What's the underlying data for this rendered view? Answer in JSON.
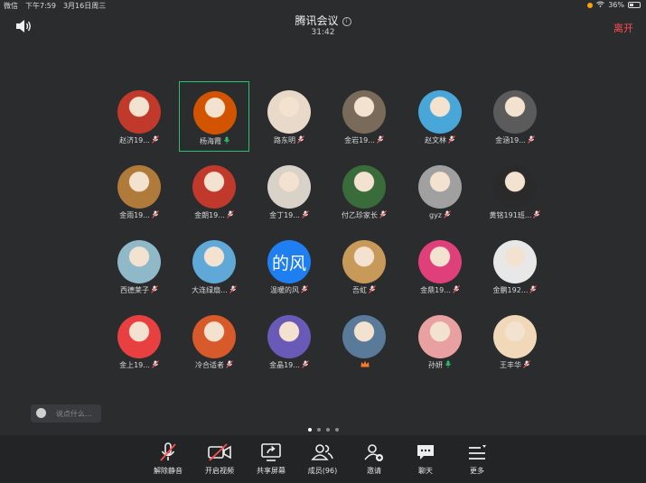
{
  "status_bar": {
    "carrier": "微信",
    "time": "下午7:59",
    "date": "3月16日周三",
    "battery": "36%"
  },
  "header": {
    "title": "腾讯会议",
    "timer": "31:42",
    "leave_label": "离开"
  },
  "participants": [
    {
      "name": "赵济19...",
      "muted": true,
      "color": "#c0392b"
    },
    {
      "name": "杨海霞",
      "muted": false,
      "active": true,
      "color": "#d35400"
    },
    {
      "name": "路东明",
      "muted": true,
      "color": "#e8d9c8"
    },
    {
      "name": "金岩19...",
      "muted": true,
      "color": "#7a6a5a"
    },
    {
      "name": "赵文林",
      "muted": true,
      "color": "#48a7d8"
    },
    {
      "name": "金涵19...",
      "muted": true,
      "color": "#5b5b5b"
    },
    {
      "name": "金雨19...",
      "muted": true,
      "color": "#b07a3a"
    },
    {
      "name": "金朗19...",
      "muted": true,
      "color": "#c0392b"
    },
    {
      "name": "金丁19...",
      "muted": true,
      "color": "#d8d2c8"
    },
    {
      "name": "付乙珍家长",
      "muted": true,
      "color": "#3a6b3a"
    },
    {
      "name": "gyz",
      "muted": true,
      "color": "#a0a0a0"
    },
    {
      "name": "黄铭191班...",
      "muted": true,
      "color": "#2a2a2a"
    },
    {
      "name": "西德莱子",
      "muted": true,
      "color": "#8fb8c8"
    },
    {
      "name": "大连绿扇...",
      "muted": true,
      "color": "#5fa8d8"
    },
    {
      "name": "温暖的风",
      "muted": true,
      "avatar_text": "的风",
      "color": "#1f7ff0"
    },
    {
      "name": "吾虹",
      "muted": true,
      "color": "#c89a5a"
    },
    {
      "name": "金鼎19...",
      "muted": true,
      "color": "#e0407a"
    },
    {
      "name": "金鹏192...",
      "muted": true,
      "color": "#e8e8e8"
    },
    {
      "name": "金上19...",
      "muted": true,
      "color": "#e84040"
    },
    {
      "name": "冷合适者",
      "muted": true,
      "color": "#d85a2a"
    },
    {
      "name": "金晶19...",
      "muted": true,
      "color": "#6a5ab8"
    },
    {
      "name": "",
      "muted": false,
      "host_crown": true,
      "color": "#5a7a9a"
    },
    {
      "name": "孙妍",
      "muted": false,
      "color": "#e8a0a0"
    },
    {
      "name": "王丰华",
      "muted": true,
      "color": "#f0d8b8"
    }
  ],
  "chat": {
    "placeholder": "说点什么..."
  },
  "pagination": {
    "pages": 4,
    "current": 1
  },
  "toolbar": [
    {
      "key": "unmute",
      "label": "解除静音",
      "icon": "mic-off-icon"
    },
    {
      "key": "video",
      "label": "开启视频",
      "icon": "camera-off-icon"
    },
    {
      "key": "share",
      "label": "共享屏幕",
      "icon": "share-screen-icon"
    },
    {
      "key": "members",
      "label": "成员(96)",
      "icon": "members-icon"
    },
    {
      "key": "invite",
      "label": "邀请",
      "icon": "invite-icon"
    },
    {
      "key": "chat",
      "label": "聊天",
      "icon": "chat-icon"
    },
    {
      "key": "more",
      "label": "更多",
      "icon": "more-icon"
    }
  ],
  "colors": {
    "accent_active": "#2fbf71",
    "leave": "#ff4d4f",
    "mic_muted": "#ff4d4f",
    "mic_on": "#2fbf71"
  }
}
